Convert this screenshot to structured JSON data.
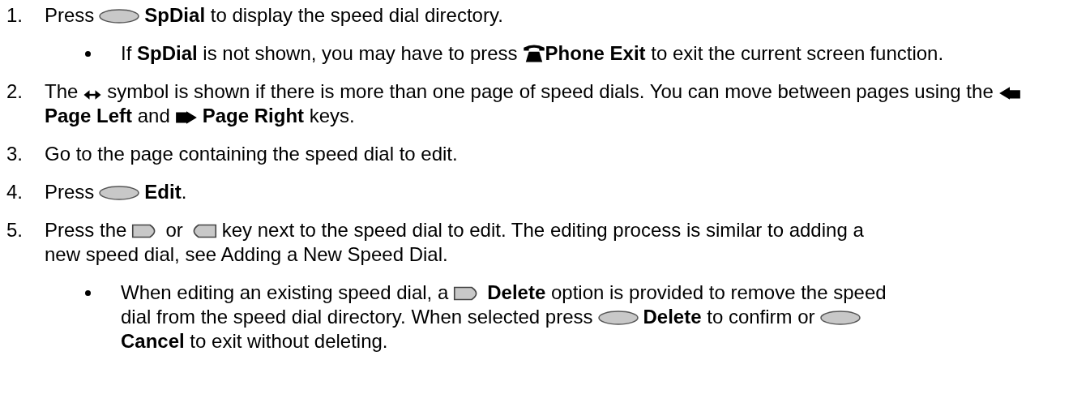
{
  "steps": [
    {
      "number": "1.",
      "segments": [
        {
          "kind": "text",
          "text": "Press"
        },
        {
          "kind": "softkey"
        },
        {
          "kind": "text",
          "text": "**SpDial** to display the speed dial directory."
        }
      ],
      "bullets": [
        {
          "segments": [
            {
              "kind": "text",
              "text": "If **SpDial** is not shown, you may have to press"
            },
            {
              "kind": "phone"
            },
            {
              "kind": "text",
              "text": "**Phone Exit** to exit the current screen"
            },
            {
              "kind": "text",
              "text": "function."
            }
          ]
        }
      ]
    },
    {
      "number": "2.",
      "segments": [
        {
          "kind": "text",
          "text": "The"
        },
        {
          "kind": "lr-arrow"
        },
        {
          "kind": "text",
          "text": "symbol is shown if there is more than one page of speed dials. You can move between"
        },
        {
          "kind": "text",
          "text": "pages using the"
        },
        {
          "kind": "left-arrow"
        },
        {
          "kind": "text",
          "text": "**Page Left** and"
        },
        {
          "kind": "right-arrow"
        },
        {
          "kind": "text",
          "text": "**Page Right** keys."
        }
      ]
    },
    {
      "number": "3.",
      "segments": [
        {
          "kind": "text",
          "text": "Go to the page containing the speed dial to edit."
        }
      ]
    },
    {
      "number": "4.",
      "segments": [
        {
          "kind": "text",
          "text": "Press"
        },
        {
          "kind": "softkey"
        },
        {
          "kind": "text",
          "text": "**Edit**."
        }
      ]
    },
    {
      "number": "5.",
      "segments": [
        {
          "kind": "text",
          "text": "Press the"
        },
        {
          "kind": "right-key"
        },
        {
          "kind": "text",
          "text": "or"
        },
        {
          "kind": "left-key"
        },
        {
          "kind": "text",
          "text": "key next to the speed dial to edit. The editing process is similar to adding a"
        },
        {
          "kind": "text",
          "text": "new speed dial, see Adding a New Speed Dial."
        }
      ],
      "bullets": [
        {
          "segments": [
            {
              "kind": "text",
              "text": "When editing an existing speed dial, a"
            },
            {
              "kind": "right-key"
            },
            {
              "kind": "text",
              "text": "**Delete** option is provided to remove the speed"
            },
            {
              "kind": "text",
              "text": "dial from the speed dial directory. When selected press"
            },
            {
              "kind": "softkey"
            },
            {
              "kind": "text",
              "text": "**Delete** to confirm or"
            },
            {
              "kind": "softkey"
            },
            {
              "kind": "text",
              "text": "**Cancel** to exit without deleting."
            }
          ]
        }
      ]
    }
  ]
}
